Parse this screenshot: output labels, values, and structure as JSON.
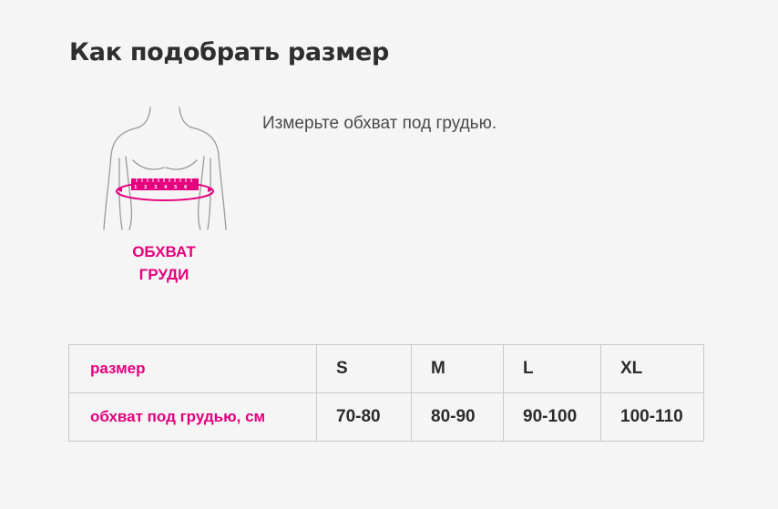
{
  "page": {
    "title": "Как подобрать размер",
    "instruction": "Измерьте обхват под грудью."
  },
  "illustration": {
    "label_line1": "ОБХВАТ",
    "label_line2": "ГРУДИ",
    "tape_numbers": [
      "1",
      "2",
      "3",
      "4",
      "5",
      "6"
    ],
    "accent_color": "#e5007e"
  },
  "size_table": {
    "rows": [
      {
        "label": "размер",
        "values": [
          "S",
          "M",
          "L",
          "XL"
        ]
      },
      {
        "label": "обхват под грудью, см",
        "values": [
          "70-80",
          "80-90",
          "90-100",
          "100-110"
        ]
      }
    ]
  }
}
